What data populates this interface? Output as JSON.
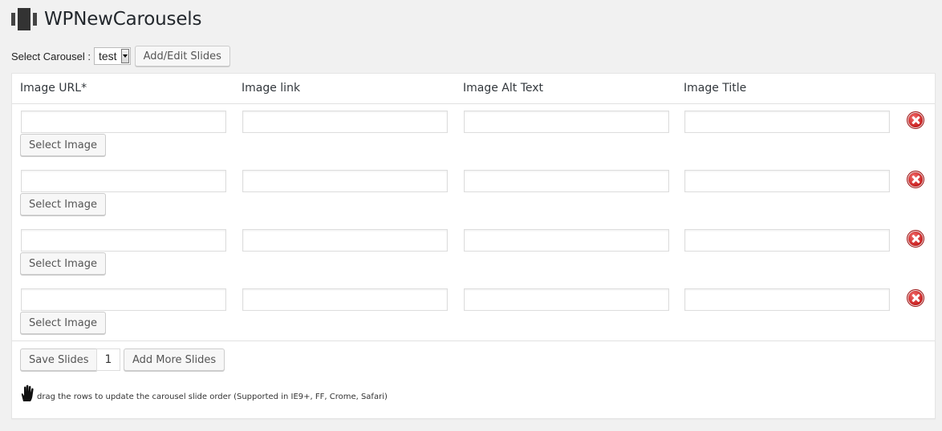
{
  "header": {
    "title": "WPNewCarousels",
    "icon": "carousel-logo-icon"
  },
  "carousel_select": {
    "label": "Select Carousel :",
    "value": "test",
    "button": "Add/Edit Slides"
  },
  "table": {
    "columns": [
      "Image URL*",
      "Image link",
      "Image Alt Text",
      "Image Title"
    ],
    "rows": [
      {
        "image_url": "",
        "image_link": "",
        "alt_text": "",
        "title": "",
        "select_label": "Select Image"
      },
      {
        "image_url": "",
        "image_link": "",
        "alt_text": "",
        "title": "",
        "select_label": "Select Image"
      },
      {
        "image_url": "",
        "image_link": "",
        "alt_text": "",
        "title": "",
        "select_label": "Select Image"
      },
      {
        "image_url": "",
        "image_link": "",
        "alt_text": "",
        "title": "",
        "select_label": "Select Image"
      }
    ]
  },
  "footer": {
    "save_label": "Save Slides",
    "count": "1",
    "add_label": "Add More Slides",
    "hint": "drag the rows to update the carousel slide order (Supported in IE9+, FF, Crome, Safari)"
  },
  "colors": {
    "delete_red": "#c41a1a",
    "page_bg": "#f1f1f1"
  }
}
